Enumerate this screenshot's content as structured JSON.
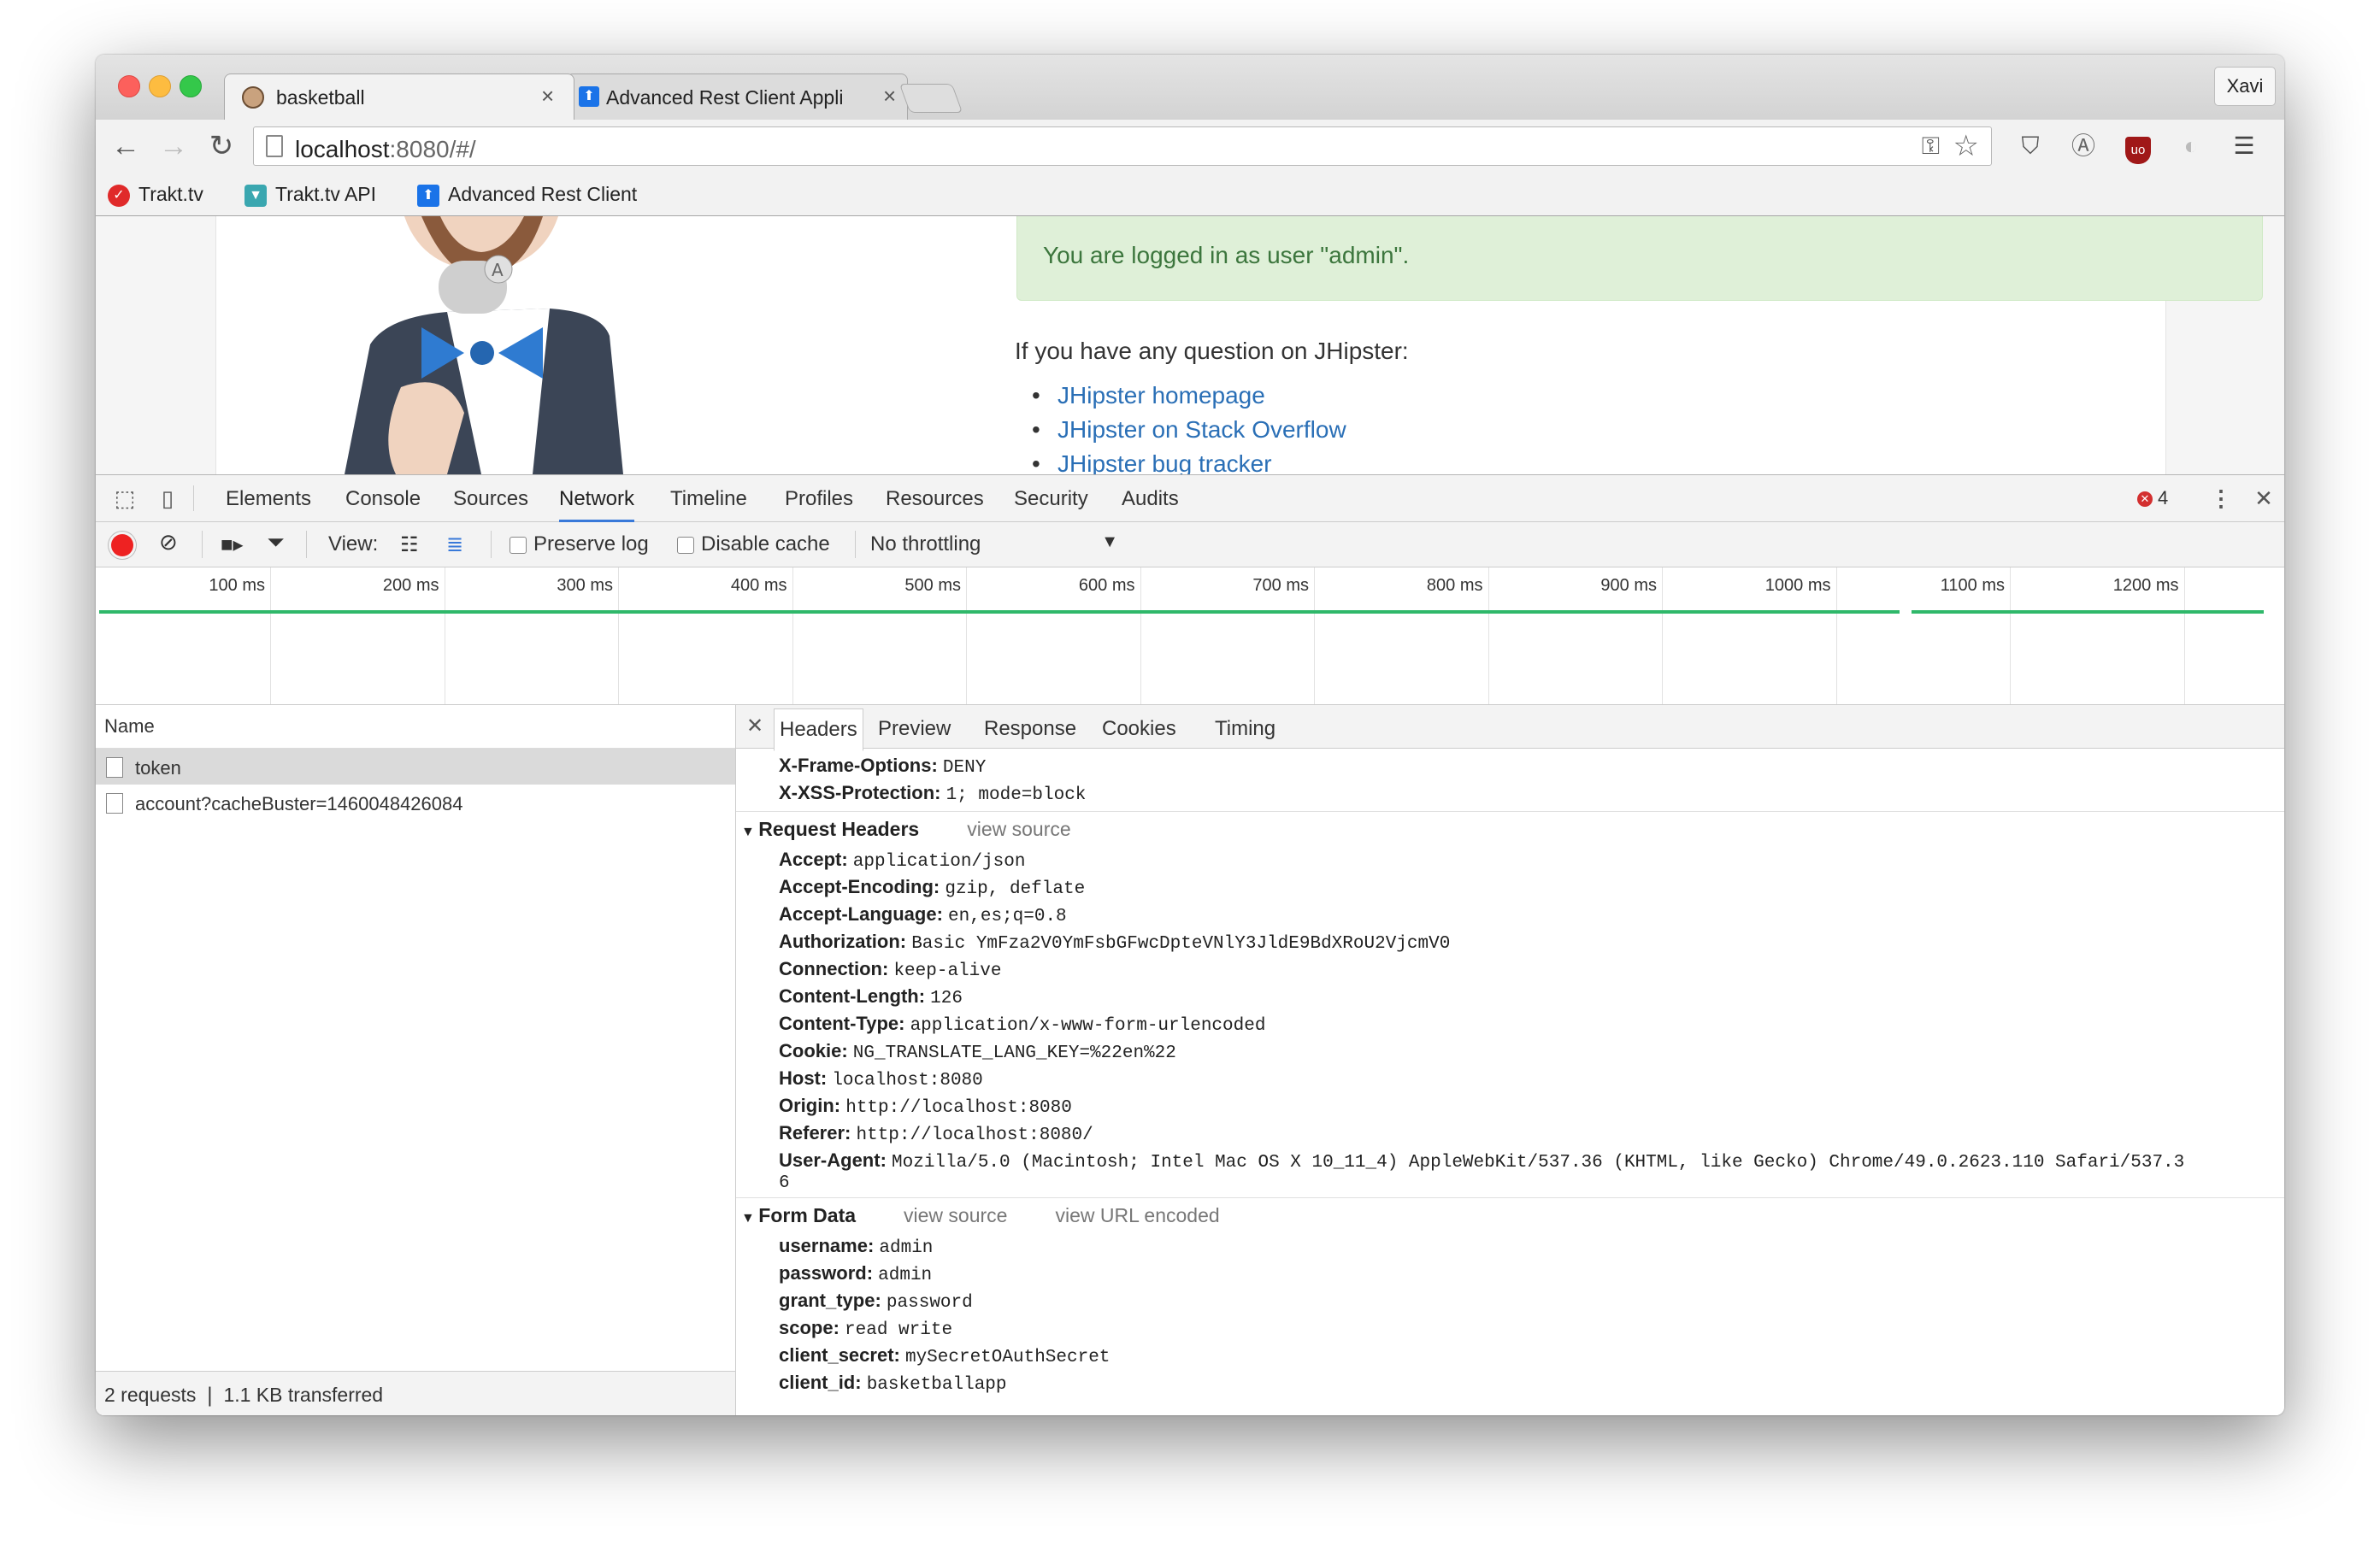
{
  "browser": {
    "tabs": [
      {
        "label": "basketball",
        "close": "×"
      },
      {
        "label": "Advanced Rest Client Appli",
        "close": "×"
      }
    ],
    "profile": "Xavi",
    "url_host": "localhost",
    "url_rest": ":8080/#/",
    "bookmarks": [
      "Trakt.tv",
      "Trakt.tv API",
      "Advanced Rest Client"
    ]
  },
  "page": {
    "alert": "You are logged in as user \"admin\".",
    "question": "If you have any question on JHipster:",
    "links": [
      "JHipster homepage",
      "JHipster on Stack Overflow",
      "JHipster bug tracker"
    ]
  },
  "devtools": {
    "tabs": [
      "Elements",
      "Console",
      "Sources",
      "Network",
      "Timeline",
      "Profiles",
      "Resources",
      "Security",
      "Audits"
    ],
    "error_count": "4",
    "toolbar": {
      "view_label": "View:",
      "preserve_log": "Preserve log",
      "disable_cache": "Disable cache",
      "throttling": "No throttling"
    },
    "timeline_ticks": [
      "100 ms",
      "200 ms",
      "300 ms",
      "400 ms",
      "500 ms",
      "600 ms",
      "700 ms",
      "800 ms",
      "900 ms",
      "1000 ms",
      "1100 ms",
      "1200 ms"
    ],
    "name_header": "Name",
    "requests": [
      "token",
      "account?cacheBuster=1460048426084"
    ],
    "summary": "2 requests  ❘  1.1 KB transferred",
    "detail_tabs": [
      "Headers",
      "Preview",
      "Response",
      "Cookies",
      "Timing"
    ],
    "response_headers_tail": [
      {
        "k": "X-Frame-Options:",
        "v": "DENY"
      },
      {
        "k": "X-XSS-Protection:",
        "v": "1; mode=block"
      }
    ],
    "request_headers_title": "Request Headers",
    "view_source": "view source",
    "view_url_encoded": "view URL encoded",
    "request_headers": [
      {
        "k": "Accept:",
        "v": "application/json"
      },
      {
        "k": "Accept-Encoding:",
        "v": "gzip, deflate"
      },
      {
        "k": "Accept-Language:",
        "v": "en,es;q=0.8"
      },
      {
        "k": "Authorization:",
        "v": "Basic YmFza2V0YmFsbGFwcDpteVNlY3JldE9BdXRoU2VjcmV0"
      },
      {
        "k": "Connection:",
        "v": "keep-alive"
      },
      {
        "k": "Content-Length:",
        "v": "126"
      },
      {
        "k": "Content-Type:",
        "v": "application/x-www-form-urlencoded"
      },
      {
        "k": "Cookie:",
        "v": "NG_TRANSLATE_LANG_KEY=%22en%22"
      },
      {
        "k": "Host:",
        "v": "localhost:8080"
      },
      {
        "k": "Origin:",
        "v": "http://localhost:8080"
      },
      {
        "k": "Referer:",
        "v": "http://localhost:8080/"
      },
      {
        "k": "User-Agent:",
        "v": "Mozilla/5.0 (Macintosh; Intel Mac OS X 10_11_4) AppleWebKit/537.36 (KHTML, like Gecko) Chrome/49.0.2623.110 Safari/537.3"
      }
    ],
    "user_agent_wrap": "6",
    "form_data_title": "Form Data",
    "form_data": [
      {
        "k": "username:",
        "v": "admin"
      },
      {
        "k": "password:",
        "v": "admin"
      },
      {
        "k": "grant_type:",
        "v": "password"
      },
      {
        "k": "scope:",
        "v": "read write"
      },
      {
        "k": "client_secret:",
        "v": "mySecretOAuthSecret"
      },
      {
        "k": "client_id:",
        "v": "basketballapp"
      }
    ]
  },
  "colors": {
    "alert_bg": "#dff0d8",
    "alert_text": "#3c763d",
    "link": "#2a6fb6",
    "record": "#ee2222",
    "timeline_bar": "#2fb86a",
    "selected_tab_underline": "#3879d9"
  }
}
